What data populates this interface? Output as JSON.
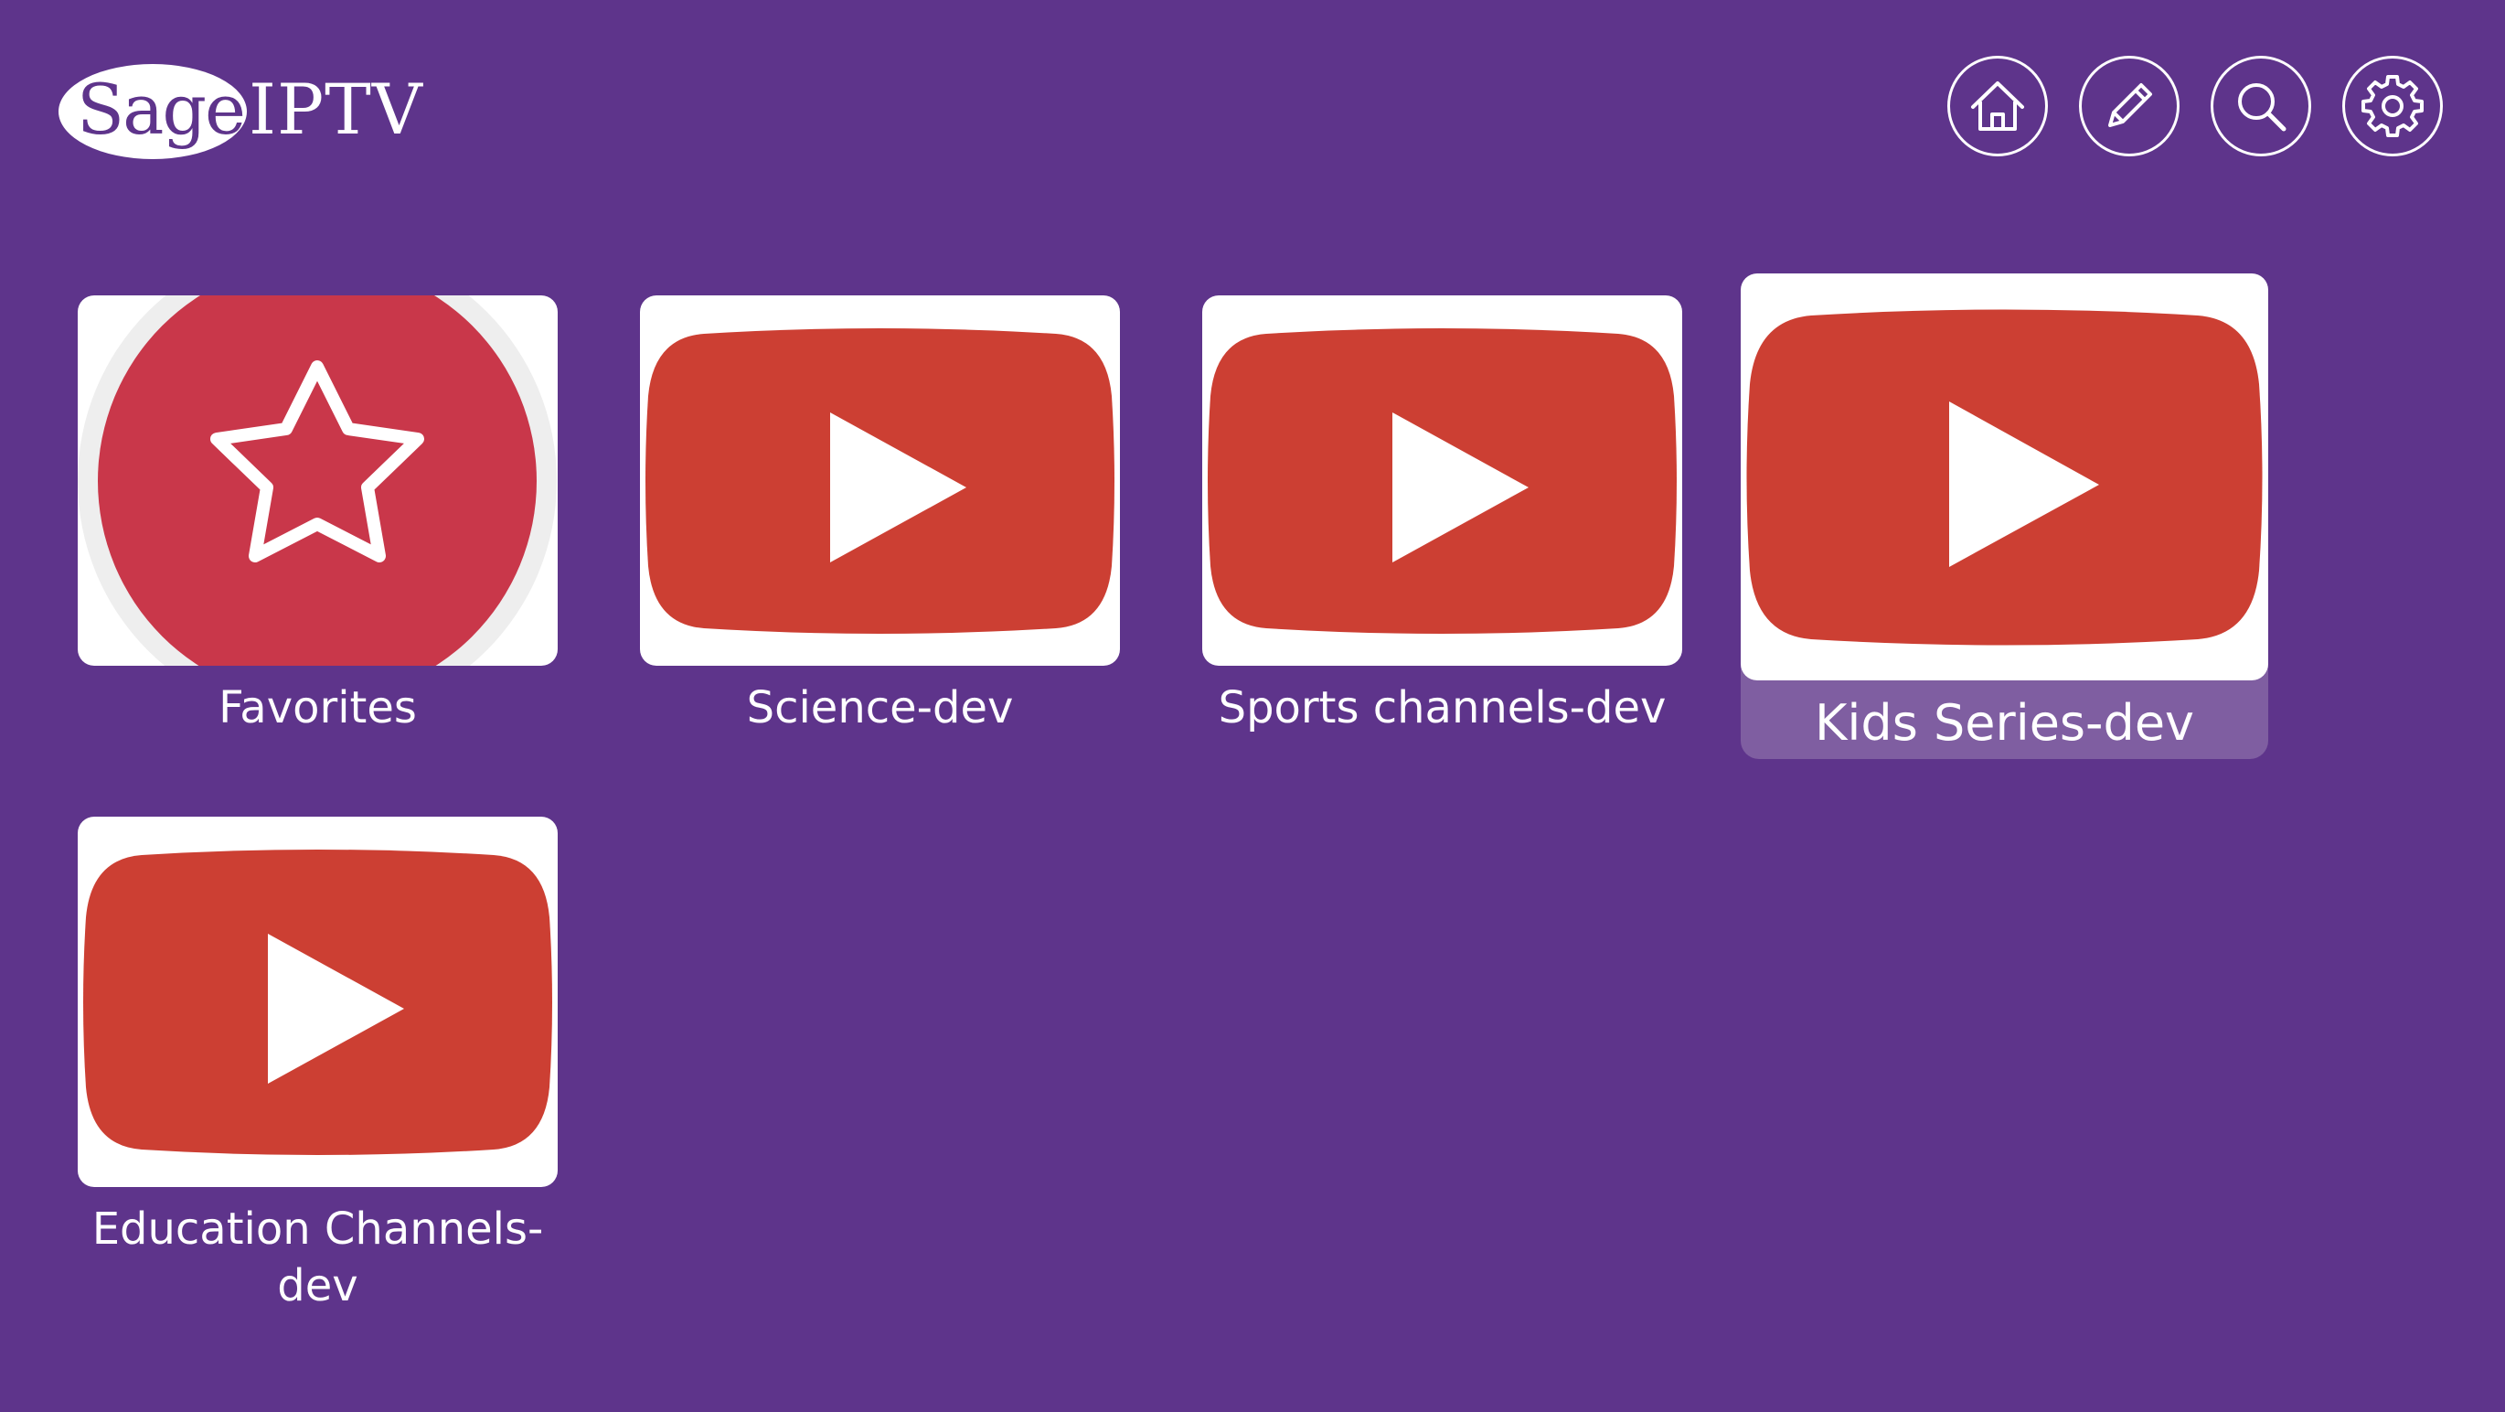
{
  "app": {
    "logo_part1": "Sage",
    "logo_part2": "IPTV"
  },
  "toolbar": [
    {
      "name": "home-button",
      "icon": "home-icon"
    },
    {
      "name": "edit-button",
      "icon": "pencil-icon"
    },
    {
      "name": "search-button",
      "icon": "search-icon"
    },
    {
      "name": "settings-button",
      "icon": "gear-icon"
    }
  ],
  "categories": [
    {
      "label": "Favorites",
      "icon": "star-icon",
      "focused": false
    },
    {
      "label": "Science-dev",
      "icon": "youtube-play-icon",
      "focused": false
    },
    {
      "label": "Sports channels-dev",
      "icon": "youtube-play-icon",
      "focused": false
    },
    {
      "label": "Kids Series-dev",
      "icon": "youtube-play-icon",
      "focused": true
    },
    {
      "label": "Education Channels-dev",
      "icon": "youtube-play-icon",
      "focused": false
    }
  ],
  "colors": {
    "background": "#5e348b",
    "focus_highlight": "#7f5ea1",
    "favorites_red": "#c9374a",
    "youtube_red": "#cc3f33",
    "icon_white": "#ffffff"
  }
}
